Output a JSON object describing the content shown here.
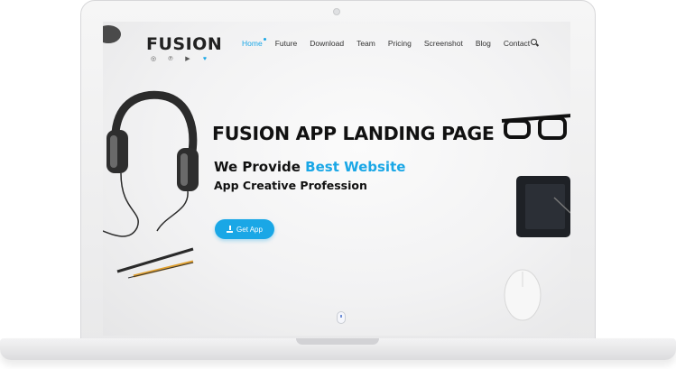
{
  "header": {
    "logo": "FUSION",
    "nav": [
      {
        "label": "Home",
        "active": true
      },
      {
        "label": "Future",
        "active": false
      },
      {
        "label": "Download",
        "active": false
      },
      {
        "label": "Team",
        "active": false
      },
      {
        "label": "Pricing",
        "active": false
      },
      {
        "label": "Screenshot",
        "active": false
      },
      {
        "label": "Blog",
        "active": false
      },
      {
        "label": "Contact",
        "active": false
      }
    ],
    "socials": [
      "dribbble-icon",
      "pinterest-icon",
      "youtube-icon",
      "twitter-icon"
    ]
  },
  "hero": {
    "title": "FUSION APP LANDING PAGE",
    "subtitle_prefix": "We Provide ",
    "subtitle_highlight": "Best Website",
    "tagline": "App Creative Profession",
    "cta_label": "Get App"
  },
  "colors": {
    "accent": "#1aa7e6",
    "text": "#111111"
  }
}
